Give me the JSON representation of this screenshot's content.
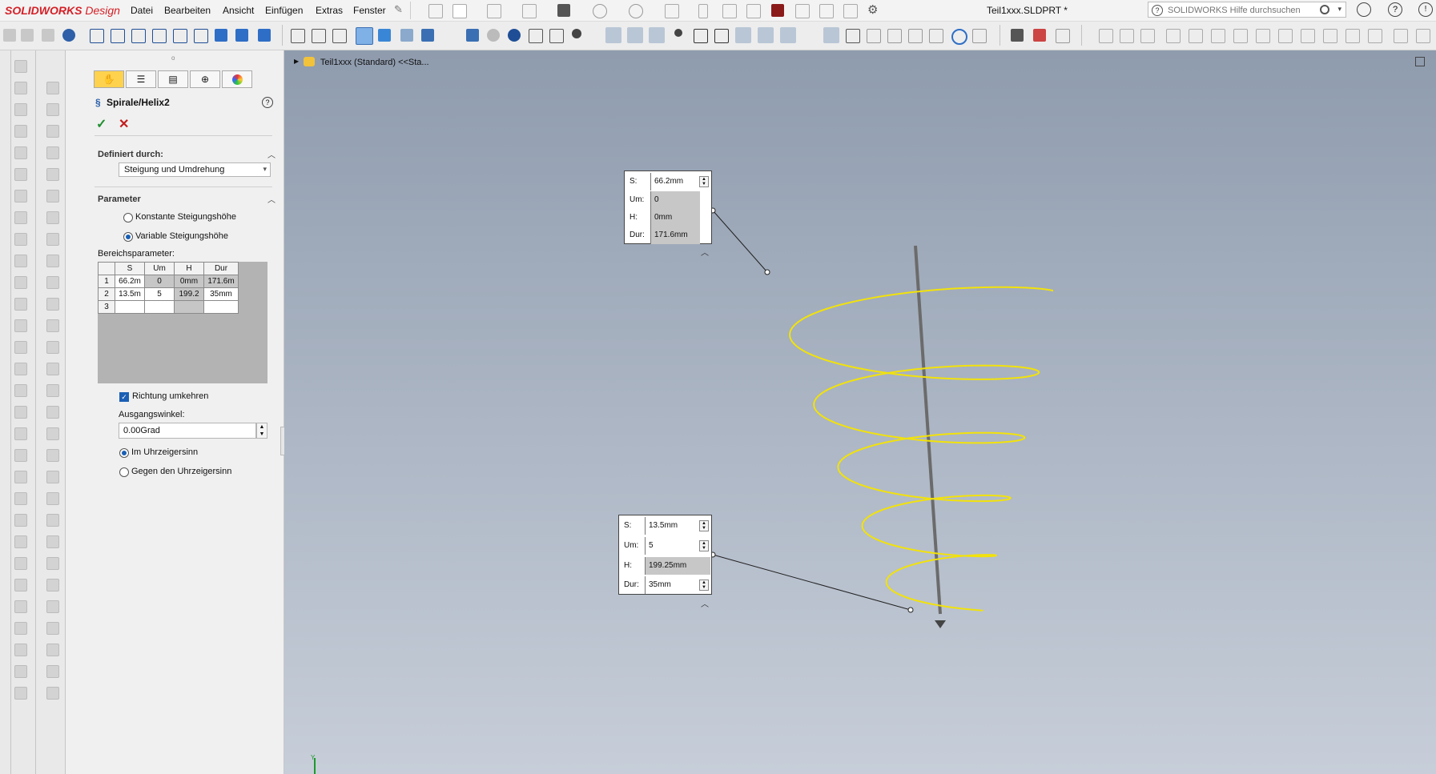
{
  "app": {
    "logo_brand": "SOLIDWORKS",
    "logo_suffix": "Design",
    "document_title": "Teil1xxx.SLDPRT *",
    "brand_color": "#d42027"
  },
  "menu": [
    "Datei",
    "Bearbeiten",
    "Ansicht",
    "Einfügen",
    "Extras",
    "Fenster"
  ],
  "help_search": {
    "placeholder": "SOLIDWORKS Hilfe durchsuchen"
  },
  "feature_tree": {
    "label": "Teil1xxx (Standard) <<Sta..."
  },
  "property_manager": {
    "title": "Spirale/Helix2",
    "defined_by": {
      "heading": "Definiert durch:",
      "selected": "Steigung und Umdrehung"
    },
    "parameters": {
      "heading": "Parameter",
      "options": [
        {
          "label": "Konstante Steigungshöhe",
          "selected": false
        },
        {
          "label": "Variable Steigungshöhe",
          "selected": true
        }
      ],
      "range_label": "Bereichsparameter:",
      "table": {
        "headers": [
          "S",
          "Um",
          "H",
          "Dur"
        ],
        "rows": [
          {
            "num": "1",
            "cells": [
              "66.2m",
              "0",
              "0mm",
              "171.6m"
            ]
          },
          {
            "num": "2",
            "cells": [
              "13.5m",
              "5",
              "199.2",
              "35mm"
            ]
          },
          {
            "num": "3",
            "cells": [
              "",
              "",
              "",
              ""
            ]
          }
        ]
      },
      "reverse_direction": {
        "label": "Richtung umkehren",
        "checked": true
      },
      "start_angle": {
        "label": "Ausgangswinkel:",
        "value": "0.00Grad"
      },
      "rotation": [
        {
          "label": "Im Uhrzeigersinn",
          "selected": true
        },
        {
          "label": "Gegen den Uhrzeigersinn",
          "selected": false
        }
      ]
    }
  },
  "callouts": [
    {
      "rows": [
        {
          "label": "S:",
          "value": "66.2mm",
          "editable": true
        },
        {
          "label": "Um:",
          "value": "0",
          "editable": false
        },
        {
          "label": "H:",
          "value": "0mm",
          "editable": false
        },
        {
          "label": "Dur:",
          "value": "171.6mm",
          "editable": false
        }
      ]
    },
    {
      "rows": [
        {
          "label": "S:",
          "value": "13.5mm",
          "editable": true
        },
        {
          "label": "Um:",
          "value": "5",
          "editable": true
        },
        {
          "label": "H:",
          "value": "199.25mm",
          "editable": false
        },
        {
          "label": "Dur:",
          "value": "35mm",
          "editable": true
        }
      ]
    }
  ],
  "colors": {
    "helix": "#f2e20a",
    "axis": "#6b6b6b"
  }
}
